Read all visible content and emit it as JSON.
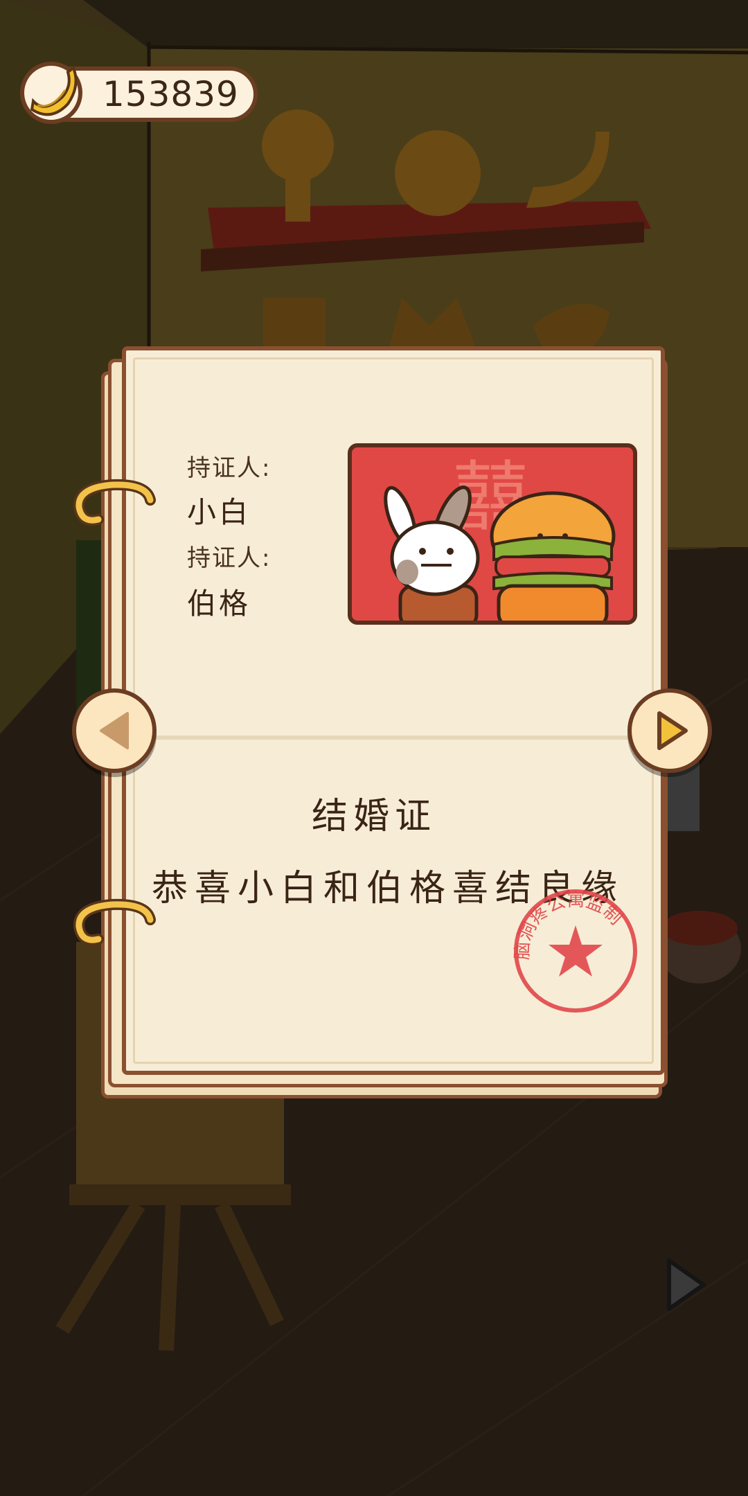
{
  "currency": {
    "count": "153839",
    "icon": "banana-icon"
  },
  "certificate": {
    "holder_label_1": "持证人:",
    "holder_name_1": "小白",
    "holder_label_2": "持证人:",
    "holder_name_2": "伯格",
    "title": "结婚证",
    "message": "恭喜小白和伯格喜结良缘",
    "photo_characters": "囍",
    "stamp_text": "脑洞疼公寓监制"
  },
  "nav": {
    "prev_icon": "triangle-left-icon",
    "next_icon": "triangle-right-icon"
  },
  "colors": {
    "paper": "#f7edd7",
    "border": "#8a5030",
    "photo_bg": "#e04845",
    "stamp": "#e0464a",
    "button": "#fbe6bf",
    "text": "#3a2416"
  }
}
